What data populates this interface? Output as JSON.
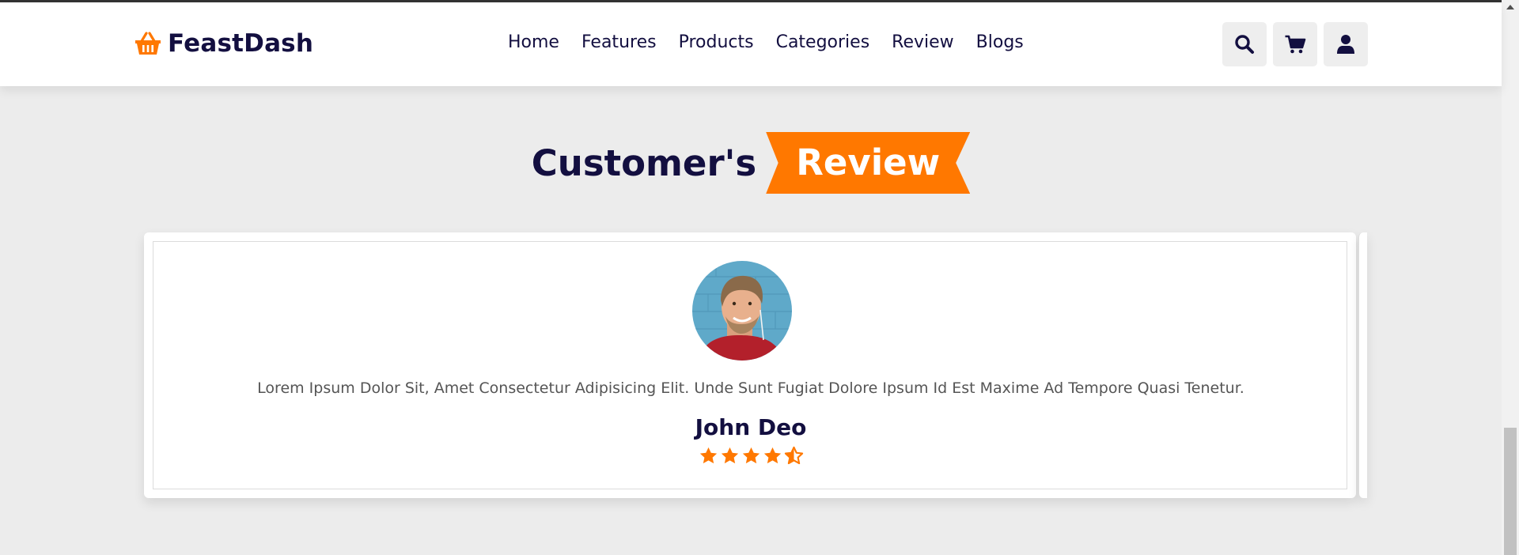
{
  "brand": {
    "name": "FeastDash",
    "icon": "basket-icon",
    "accent": "#ff7800",
    "dark": "#130f40"
  },
  "nav": [
    "Home",
    "Features",
    "Products",
    "Categories",
    "Review",
    "Blogs"
  ],
  "header_icons": [
    "search-icon",
    "cart-icon",
    "user-icon"
  ],
  "section": {
    "title_main": "Customer's",
    "title_accent": "Review"
  },
  "review": {
    "text": "Lorem Ipsum Dolor Sit, Amet Consectetur Adipisicing Elit. Unde Sunt Fugiat Dolore Ipsum Id Est Maxime Ad Tempore Quasi Tenetur.",
    "name": "John Deo",
    "rating": 4.5,
    "rating_max": 5
  }
}
